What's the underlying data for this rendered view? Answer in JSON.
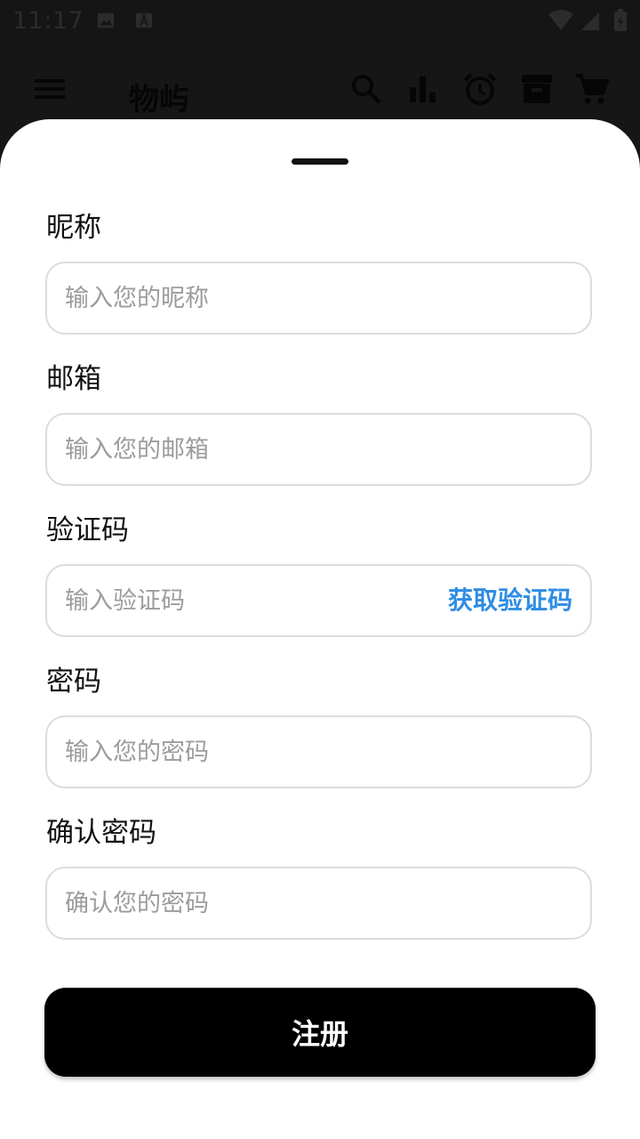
{
  "status_bar": {
    "time": "11:17",
    "icons": [
      "image-icon",
      "a-notification-icon",
      "wifi-icon",
      "cellular-icon",
      "battery-icon"
    ]
  },
  "app_bar": {
    "title": "物屿",
    "icons": [
      "menu-icon",
      "search-icon",
      "bar-chart-icon",
      "alarm-icon",
      "archive-icon",
      "cart-icon"
    ]
  },
  "form": {
    "nickname": {
      "label": "昵称",
      "placeholder": "输入您的昵称",
      "value": ""
    },
    "email": {
      "label": "邮箱",
      "placeholder": "输入您的邮箱",
      "value": ""
    },
    "code": {
      "label": "验证码",
      "placeholder": "输入验证码",
      "value": "",
      "action": "获取验证码"
    },
    "password": {
      "label": "密码",
      "placeholder": "输入您的密码",
      "value": ""
    },
    "confirm": {
      "label": "确认密码",
      "placeholder": "确认您的密码",
      "value": ""
    },
    "submit_label": "注册"
  },
  "colors": {
    "link": "#2f8de4",
    "button": "#000000",
    "overlay": "#161616"
  }
}
